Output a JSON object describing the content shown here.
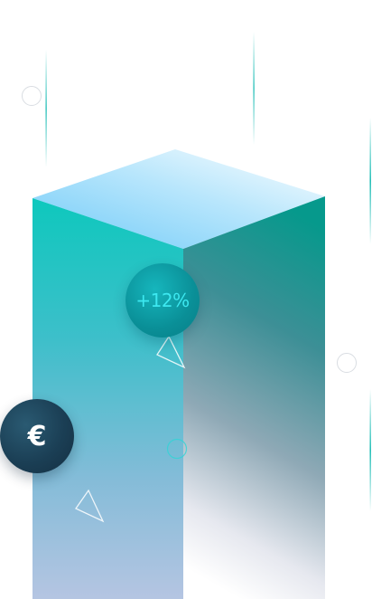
{
  "graphic": {
    "percent_badge_text": "+12%",
    "currency_badge_symbol": "€",
    "colors": {
      "teal": "#0ec5bd",
      "teal_dark": "#079a8e",
      "sky_blue": "#8fd6fb",
      "navy": "#1b3f55",
      "badge_text_cyan": "#3de8f0"
    },
    "icons": [
      "currency-euro-icon",
      "percent-growth-badge"
    ]
  }
}
